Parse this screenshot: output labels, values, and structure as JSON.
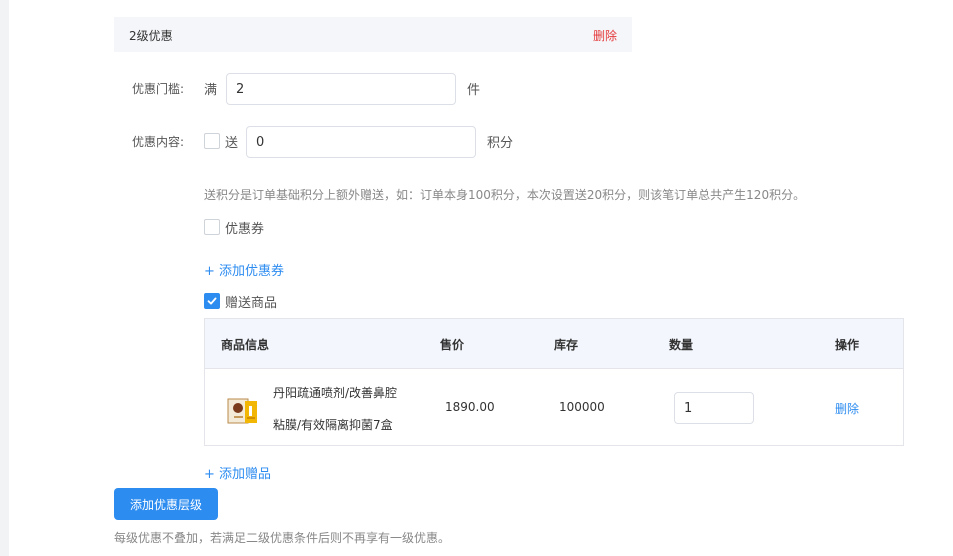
{
  "tier": {
    "title": "2级优惠",
    "delete_label": "删除"
  },
  "threshold": {
    "label": "优惠门槛:",
    "prefix": "满",
    "value": "2",
    "unit": "件"
  },
  "content": {
    "label": "优惠内容:",
    "points_checkbox_label": "送",
    "points_checked": false,
    "points_value": "0",
    "points_unit": "积分",
    "points_hint": "送积分是订单基础积分上额外赠送，如：订单本身100积分，本次设置送20积分，则该笔订单总共产生120积分。",
    "coupon_label": "优惠券",
    "coupon_checked": false,
    "add_coupon": "+ 添加优惠券",
    "gift_label": "赠送商品",
    "gift_checked": true,
    "add_gift": "+ 添加赠品"
  },
  "gift_table": {
    "headers": {
      "info": "商品信息",
      "price": "售价",
      "stock": "库存",
      "quantity": "数量",
      "action": "操作"
    },
    "rows": [
      {
        "name_line1": "丹阳疏通喷剂/改善鼻腔",
        "name_line2": "粘膜/有效隔离抑菌7盒",
        "price": "1890.00",
        "stock": "100000",
        "quantity": "1",
        "action": "删除"
      }
    ]
  },
  "add_tier_button": "添加优惠层级",
  "footer_note": "每级优惠不叠加，若满足二级优惠条件后则不再享有一级优惠。",
  "colors": {
    "primary": "#2d8cf0",
    "danger": "#e4393c"
  }
}
